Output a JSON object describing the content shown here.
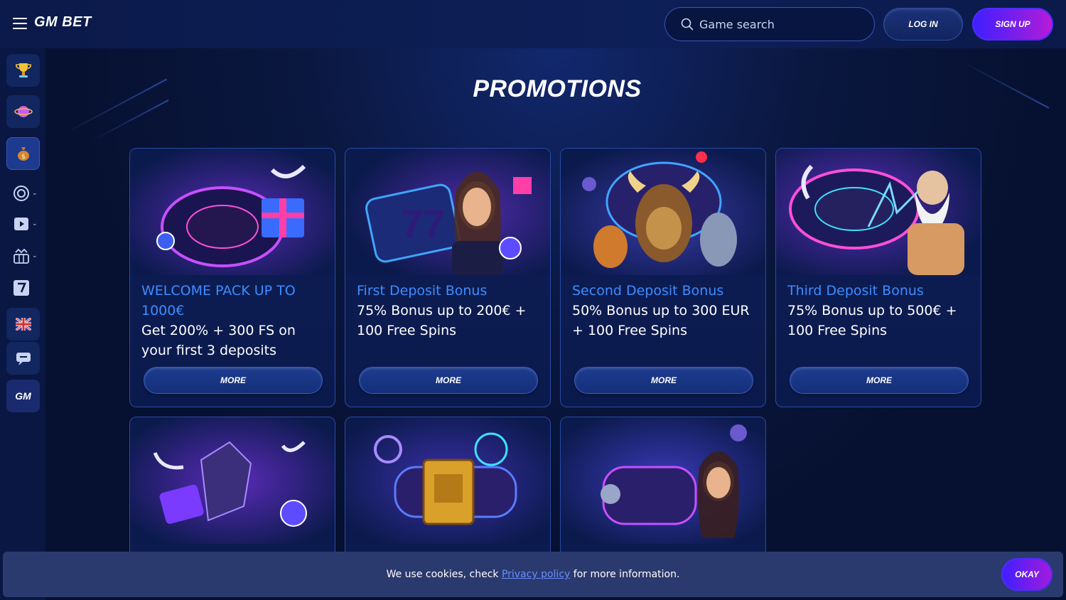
{
  "header": {
    "logo": "GM BET",
    "search_placeholder": "Game search",
    "login_label": "LOG IN",
    "signup_label": "SIGN UP"
  },
  "sidebar": {
    "items": [
      {
        "icon": "trophy-icon"
      },
      {
        "icon": "planet-icon"
      },
      {
        "icon": "money-bag-icon"
      },
      {
        "icon": "casino-chip-icon"
      },
      {
        "icon": "live-play-icon"
      },
      {
        "icon": "slot-machine-icon"
      },
      {
        "icon": "seven-icon"
      },
      {
        "icon": "uk-flag-icon"
      },
      {
        "icon": "chat-icon"
      },
      {
        "icon": "gm-logo-icon",
        "label": "GM"
      }
    ]
  },
  "main": {
    "title": "PROMOTIONS",
    "cards": [
      {
        "title": "WELCOME PACK UP TO 1000€",
        "desc": "Get 200% + 300 FS on your first 3 deposits",
        "more": "MORE"
      },
      {
        "title": "First Deposit Bonus",
        "desc": "75% Bonus up to 200€ + 100 Free Spins",
        "more": "MORE"
      },
      {
        "title": "Second Deposit Bonus",
        "desc": "50% Bonus up to 300 EUR + 100 Free Spins",
        "more": "MORE"
      },
      {
        "title": "Third Deposit Bonus",
        "desc": "75% Bonus up to 500€ + 100 Free Spins",
        "more": "MORE"
      }
    ]
  },
  "cookie": {
    "text_before": "We use cookies, check",
    "link": "Privacy policy",
    "text_after": "for more information.",
    "okay_label": "OKAY"
  }
}
